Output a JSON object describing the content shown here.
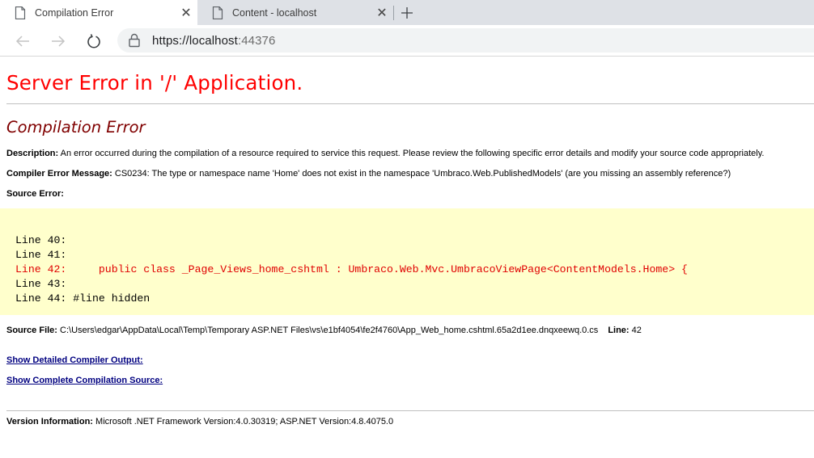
{
  "browser": {
    "tabs": [
      {
        "title": "Compilation Error",
        "close": "✕"
      },
      {
        "title": "Content - localhost",
        "close": "✕"
      }
    ],
    "new_tab": "+",
    "url": {
      "host": "https://localhost",
      "port": ":44376"
    }
  },
  "page": {
    "heading": "Server Error in '/' Application.",
    "subheading": "Compilation Error",
    "description_label": "Description:",
    "description_text": " An error occurred during the compilation of a resource required to service this request. Please review the following specific error details and modify your source code appropriately.",
    "compiler_label": "Compiler Error Message:",
    "compiler_text": " CS0234: The type or namespace name 'Home' does not exist in the namespace 'Umbraco.Web.PublishedModels' (are you missing an assembly reference?)",
    "source_error_label": "Source Error:",
    "code_lines": [
      {
        "text": "Line 40:",
        "error": false
      },
      {
        "text": "Line 41:",
        "error": false
      },
      {
        "text": "Line 42:     public class _Page_Views_home_cshtml : Umbraco.Web.Mvc.UmbracoViewPage<ContentModels.Home> {",
        "error": true
      },
      {
        "text": "Line 43:",
        "error": false
      },
      {
        "text": "Line 44: #line hidden",
        "error": false
      }
    ],
    "source_file_label": "Source File:",
    "source_file_path": " C:\\Users\\edgar\\AppData\\Local\\Temp\\Temporary ASP.NET Files\\vs\\e1bf4054\\fe2f4760\\App_Web_home.cshtml.65a2d1ee.dnqxeewq.0.cs",
    "line_label": "Line:",
    "line_number": " 42",
    "link_detailed": "Show Detailed Compiler Output:",
    "link_complete": "Show Complete Compilation Source:",
    "version_label": "Version Information:",
    "version_text": " Microsoft .NET Framework Version:4.0.30319; ASP.NET Version:4.8.4075.0"
  },
  "colors": {
    "heading": "#ff0000",
    "subheading": "#800000",
    "code_bg": "#ffffcc",
    "code_error": "#e00000",
    "link": "#000080"
  }
}
